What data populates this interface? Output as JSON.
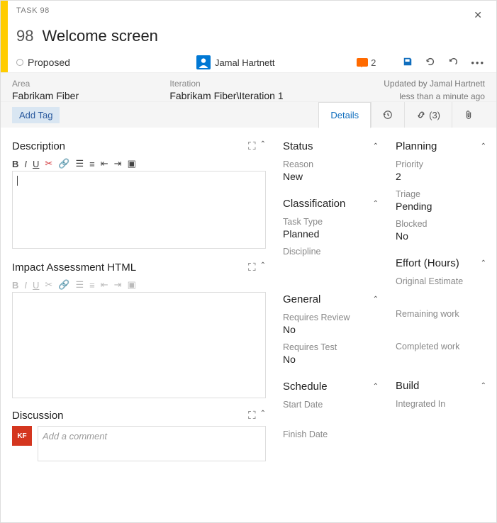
{
  "header": {
    "task_label": "TASK 98",
    "id": "98",
    "title": "Welcome screen"
  },
  "meta": {
    "state": "Proposed",
    "assignee": "Jamal Hartnett",
    "comment_count": "2"
  },
  "info": {
    "area_label": "Area",
    "area_value": "Fabrikam Fiber",
    "iteration_label": "Iteration",
    "iteration_value": "Fabrikam Fiber\\Iteration 1",
    "updated_by": "Updated by Jamal Hartnett",
    "updated_when": "less than a minute ago"
  },
  "tags": {
    "add": "Add Tag"
  },
  "tabs": {
    "details": "Details",
    "links_count": "(3)"
  },
  "left": {
    "description": "Description",
    "impact": "Impact Assessment HTML",
    "discussion": "Discussion",
    "add_comment": "Add a comment",
    "disc_initials": "KF"
  },
  "mid": {
    "status": "Status",
    "reason_lbl": "Reason",
    "reason_val": "New",
    "classification": "Classification",
    "tasktype_lbl": "Task Type",
    "tasktype_val": "Planned",
    "discipline_lbl": "Discipline",
    "general": "General",
    "reqreview_lbl": "Requires Review",
    "reqreview_val": "No",
    "reqtest_lbl": "Requires Test",
    "reqtest_val": "No",
    "schedule": "Schedule",
    "start_lbl": "Start Date",
    "finish_lbl": "Finish Date"
  },
  "right": {
    "planning": "Planning",
    "priority_lbl": "Priority",
    "priority_val": "2",
    "triage_lbl": "Triage",
    "triage_val": "Pending",
    "blocked_lbl": "Blocked",
    "blocked_val": "No",
    "effort": "Effort (Hours)",
    "orig_lbl": "Original Estimate",
    "remain_lbl": "Remaining work",
    "complete_lbl": "Completed work",
    "build": "Build",
    "integrated_lbl": "Integrated In"
  }
}
